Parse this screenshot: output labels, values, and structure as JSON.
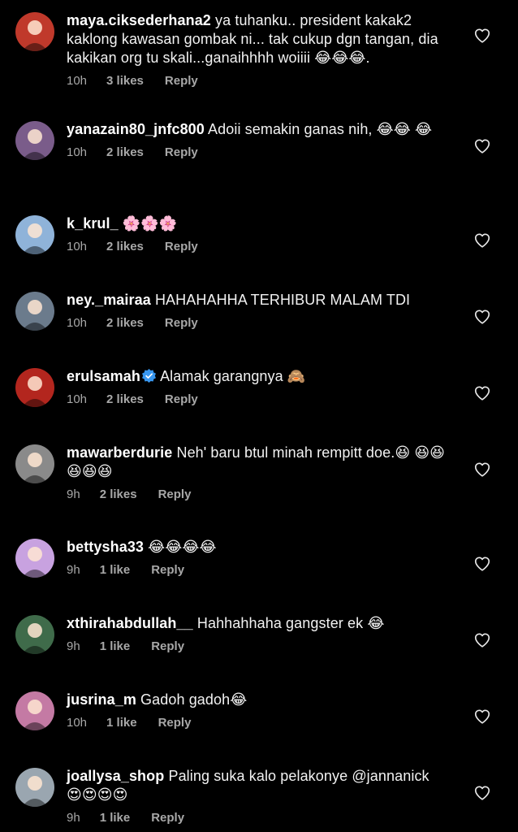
{
  "comments": [
    {
      "username": "maya.ciksederhana2",
      "text": "ya tuhanku.. president kakak2 kaklong kawasan gombak ni... tak cukup dgn tangan, dia kakikan org tu skali...ganaihhhh woiiii 😂😂😂.",
      "time": "10h",
      "likes": "3 likes",
      "reply": "Reply",
      "avatar_color": "#c0392b",
      "avatar_icon": "avatar-photo"
    },
    {
      "username": "yanazain80_jnfc800",
      "text": "Adoii semakin ganas nih, 😂😂 😂",
      "time": "10h",
      "likes": "2 likes",
      "reply": "Reply",
      "avatar_color": "#7a5c8a",
      "avatar_icon": "avatar-photo"
    },
    {
      "username": "k_krul_",
      "text": "🌸🌸🌸",
      "time": "10h",
      "likes": "2 likes",
      "reply": "Reply",
      "avatar_color": "#8fb3d9",
      "avatar_icon": "avatar-photo"
    },
    {
      "username": "ney._mairaa",
      "text": "HAHAHAHHA TERHIBUR MALAM TDI",
      "time": "10h",
      "likes": "2 likes",
      "reply": "Reply",
      "avatar_color": "#6b7b8c",
      "avatar_icon": "avatar-photo"
    },
    {
      "username": "erulsamah",
      "verified": true,
      "text": "Alamak garangnya 🙈",
      "time": "10h",
      "likes": "2 likes",
      "reply": "Reply",
      "avatar_color": "#b3261e",
      "avatar_icon": "avatar-photo"
    },
    {
      "username": "mawarberdurie",
      "text": "Neh' baru btul minah rempitt doe.😆 😆😆😆😆😆",
      "time": "9h",
      "likes": "2 likes",
      "reply": "Reply",
      "avatar_color": "#8a8a8a",
      "avatar_icon": "avatar-photo"
    },
    {
      "username": "bettysha33",
      "text": "😂😂😂😂",
      "time": "9h",
      "likes": "1 like",
      "reply": "Reply",
      "avatar_color": "#c8a2e0",
      "avatar_icon": "avatar-photo"
    },
    {
      "username": "xthirahabdullah__",
      "text": "Hahhahhaha gangster ek 😂",
      "time": "9h",
      "likes": "1 like",
      "reply": "Reply",
      "avatar_color": "#3f6b4a",
      "avatar_icon": "avatar-photo"
    },
    {
      "username": "jusrina_m",
      "text": "Gadoh gadoh😂",
      "time": "10h",
      "likes": "1 like",
      "reply": "Reply",
      "avatar_color": "#c47aa4",
      "avatar_icon": "avatar-photo"
    },
    {
      "username": "joallysa_shop",
      "text": "Paling suka kalo pelakonye @jannanick 😍😍😍😍",
      "time": "9h",
      "likes": "1 like",
      "reply": "Reply",
      "avatar_color": "#9aa6b0",
      "avatar_icon": "avatar-photo"
    }
  ],
  "colors": {
    "background": "#000000",
    "text": "#f5f5f5",
    "meta": "#a8a8a8",
    "verified": "#3897f0"
  }
}
